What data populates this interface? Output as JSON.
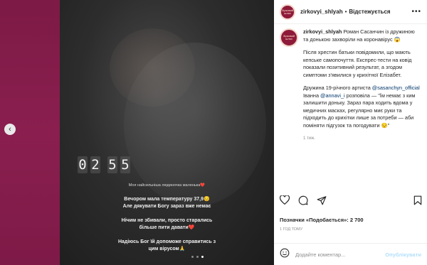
{
  "post": {
    "username": "zirkovyi_shlyah",
    "follow_label": "Відстежується",
    "avatar_text": "Зірковий шлях",
    "caption": {
      "headline": "Роман Сасанчин із дружиною та донькою захворіли на коронавірус 😱",
      "paragraph1": "Після хрестин батьки повідомили, що мають кепське самопочуття. Експрес-тести на ковід показали позитивний результат, а згодом симптоми з'явилися у крихітної Елізабет.",
      "paragraph2_before": "Дружина 19-річного артиста ",
      "mention1": "@sasanchyn_official",
      "paragraph2_mid": " Іванна ",
      "mention2": "@annavi_i",
      "paragraph2_after": " розповіла — \"Їм немає з ким залишити доньку. Зараз пара ходить вдома у медичних масках, регулярно миє руки та підходить до крихітки лише за потреби — аби поміняти підгузок та погодувати 😔\"",
      "time_ago": "1 тиж."
    },
    "likes_label": "Позначки «Подобається»: 2 700",
    "post_time": "1 год тому",
    "comment_placeholder": "Додайте коментар...",
    "publish_label": "Опублікувати"
  },
  "story": {
    "timer": [
      "0",
      "2",
      "5",
      "5"
    ],
    "small_caption": "Моя найсильніша людиночка маленька❤️",
    "line1": "Вечором мала температуру 37,9😔",
    "line2": "Але дякувати Богу зараз вже немає",
    "line3": "Нічим не збивали, просто старались",
    "line4": "більше пити давати❤️",
    "line5": "Надіюсь Бог їй допоможе справитись з",
    "line6": "цим вірусом🙏",
    "dots": 3,
    "active_dot": 2
  },
  "icons": {
    "prev": "chevron-left-icon",
    "heart": "heart-icon",
    "comment": "comment-icon",
    "share": "share-icon",
    "save": "bookmark-icon",
    "emoji": "smiley-icon",
    "more": "more-dots-icon"
  },
  "colors": {
    "backdrop": "#8a1d4a",
    "link": "#00376b",
    "publish_disabled": "#b2dffc",
    "brand_avatar": "#8e1a3a"
  }
}
